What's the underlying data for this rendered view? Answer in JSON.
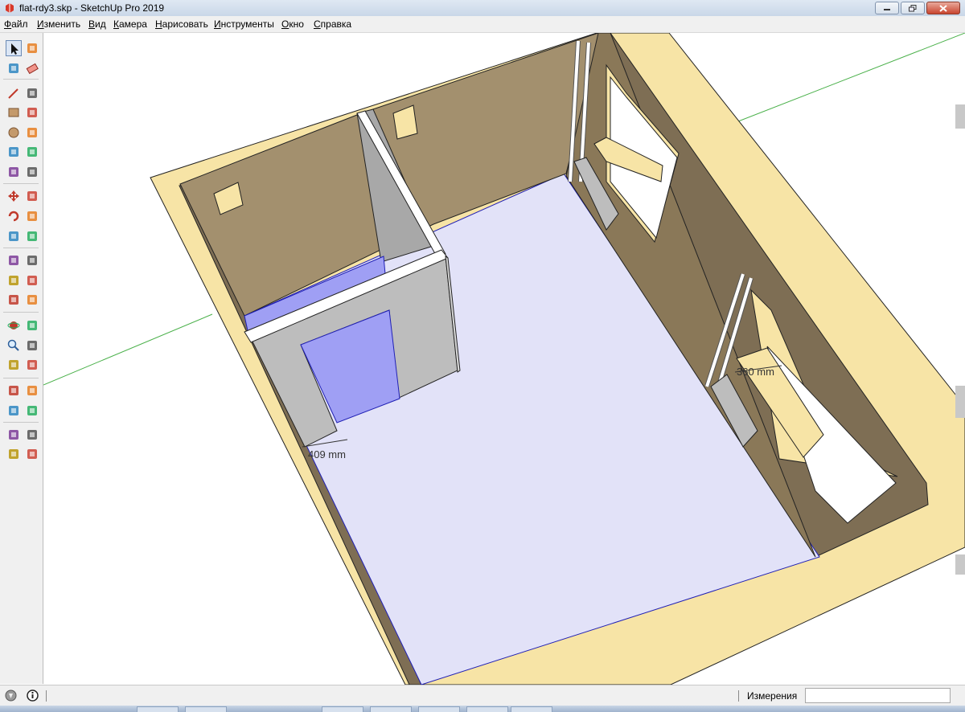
{
  "window": {
    "title": "flat-rdy3.skp - SketchUp Pro 2019",
    "app_icon": "sketchup-logo-icon",
    "controls": {
      "minimize": "minimize-icon",
      "restore": "restore-icon",
      "close": "close-icon"
    }
  },
  "menu": {
    "items": [
      "Файл",
      "Изменить",
      "Вид",
      "Камера",
      "Нарисовать",
      "Инструменты",
      "Окно",
      "Справка"
    ]
  },
  "toolbar": {
    "tools": [
      "select-tool-icon",
      "make-component-icon",
      "paint-bucket-icon",
      "eraser-icon",
      "pencil-line-icon",
      "freehand-icon",
      "rectangle-icon",
      "rotated-rectangle-icon",
      "circle-icon",
      "polygon-icon",
      "arc-icon",
      "two-point-arc-icon",
      "three-point-arc-icon",
      "pie-icon",
      "move-icon",
      "push-pull-icon",
      "rotate-icon",
      "follow-me-icon",
      "scale-icon",
      "offset-icon",
      "tape-measure-icon",
      "dimension-icon",
      "protractor-icon",
      "text-icon",
      "axes-icon",
      "3d-text-icon",
      "orbit-icon",
      "pan-icon",
      "zoom-icon",
      "zoom-window-icon",
      "zoom-extents-icon",
      "previous-view-icon",
      "position-camera-icon",
      "look-around-icon",
      "walk-icon",
      "section-plane-icon",
      "3d-warehouse-icon",
      "extension-warehouse-icon",
      "layout-send-icon",
      "extension-manager-icon"
    ],
    "selected": "select-tool-icon"
  },
  "viewport": {
    "dimension_labels": [
      "409 mm",
      "360 mm"
    ],
    "colors": {
      "floor": "#e2e2f8",
      "wall_top": "#f7e4a6",
      "wall_inner": "#a3906e",
      "wall_inner_dark": "#7e6e54",
      "partition": "#bfbfbf",
      "glass": "#9f9ff4",
      "red_axis": "#c83a3a",
      "green_axis": "#49b049",
      "blue_axis": "#3a3ad0"
    }
  },
  "statusbar": {
    "icons": [
      "geolocation-icon",
      "credits-icon",
      "instructor-info-icon"
    ],
    "measurements_label": "Измерения",
    "measurements_value": ""
  }
}
